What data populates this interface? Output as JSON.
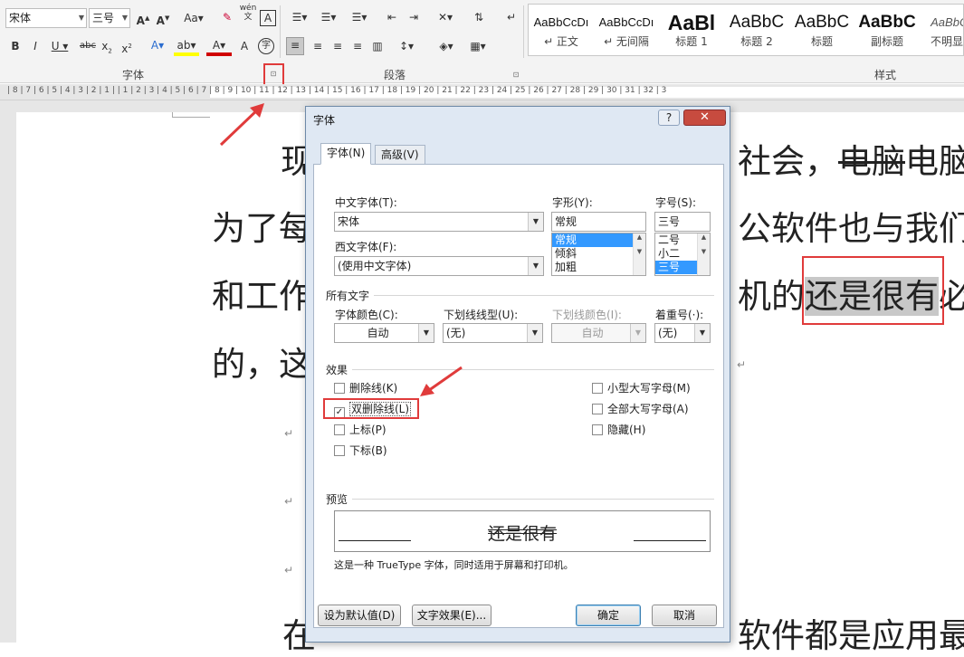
{
  "ribbon": {
    "font_name": "宋体",
    "font_size": "三号",
    "group_font_label": "字体",
    "group_paragraph_label": "段落",
    "group_styles_label": "样式",
    "phonetic_label": "wén\n文",
    "styles": [
      {
        "preview": "AaBbCcDı",
        "name": "↵ 正文"
      },
      {
        "preview": "AaBbCcDı",
        "name": "↵ 无间隔"
      },
      {
        "preview": "AaBl",
        "name": "标题 1"
      },
      {
        "preview": "AaBbC",
        "name": "标题 2"
      },
      {
        "preview": "AaBbC",
        "name": "标题"
      },
      {
        "preview": "AaBbC",
        "name": "副标题"
      },
      {
        "preview": "AaBbCc",
        "name": "不明显强"
      }
    ]
  },
  "ruler": {
    "numbers": "| 8 | 7 | 6 | 5 | 4 | 3 | 2 | 1 |   | 1 | 2 | 3 | 4 | 5 | 6 | 7 | 8 | 9 | 10 | 11 | 12 | 13 | 14 | 15 | 16 | 17 | 18 | 19 | 20 | 21 | 22 | 23 | 24 | 25 | 26 | 27 | 28 | 29 | 30 | 31 | 32 | 3"
  },
  "document": {
    "line1_left": "现",
    "line1_right_a": "社会，",
    "line1_right_strike": "电脑",
    "line1_right_b": "电脑",
    "line2_left": "为了每",
    "line2_right": "公软件也与我们",
    "line3_left": "和工作",
    "line3_right_a": "机的",
    "line3_highlight": "还是很有",
    "line3_right_b": "必",
    "line4_left": "的，这",
    "line5_left": "在",
    "line5_right": "软件都是应用最",
    "para_mark": "↵"
  },
  "dialog": {
    "title": "字体",
    "help": "?",
    "close": "✕",
    "tabs": [
      "字体(N)",
      "高级(V)"
    ],
    "cn_font_label": "中文字体(T):",
    "cn_font_value": "宋体",
    "west_font_label": "西文字体(F):",
    "west_font_value": "(使用中文字体)",
    "style_label": "字形(Y):",
    "style_value": "常规",
    "style_options": [
      "常规",
      "倾斜",
      "加粗"
    ],
    "size_label": "字号(S):",
    "size_value": "三号",
    "size_options": [
      "二号",
      "小二",
      "三号"
    ],
    "all_text_label": "所有文字",
    "font_color_label": "字体颜色(C):",
    "font_color_value": "自动",
    "underline_style_label": "下划线线型(U):",
    "underline_style_value": "(无)",
    "underline_color_label": "下划线颜色(I):",
    "underline_color_value": "自动",
    "emphasis_label": "着重号(·):",
    "emphasis_value": "(无)",
    "effects_label": "效果",
    "effects_left": [
      {
        "label": "删除线(K)",
        "checked": false
      },
      {
        "label": "双删除线(L)",
        "checked": true
      },
      {
        "label": "上标(P)",
        "checked": false
      },
      {
        "label": "下标(B)",
        "checked": false
      }
    ],
    "effects_right": [
      {
        "label": "小型大写字母(M)",
        "checked": false
      },
      {
        "label": "全部大写字母(A)",
        "checked": false
      },
      {
        "label": "隐藏(H)",
        "checked": false
      }
    ],
    "preview_label": "预览",
    "preview_text": "还是很有",
    "preview_note": "这是一种 TrueType 字体，同时适用于屏幕和打印机。",
    "btn_default": "设为默认值(D)",
    "btn_effects": "文字效果(E)...",
    "btn_ok": "确定",
    "btn_cancel": "取消"
  },
  "colors": {
    "annotation_red": "#e03b3b",
    "highlight_gray": "#c8c8c8",
    "font_color_red": "#d00000",
    "highlight_yellow": "#ffff00"
  }
}
